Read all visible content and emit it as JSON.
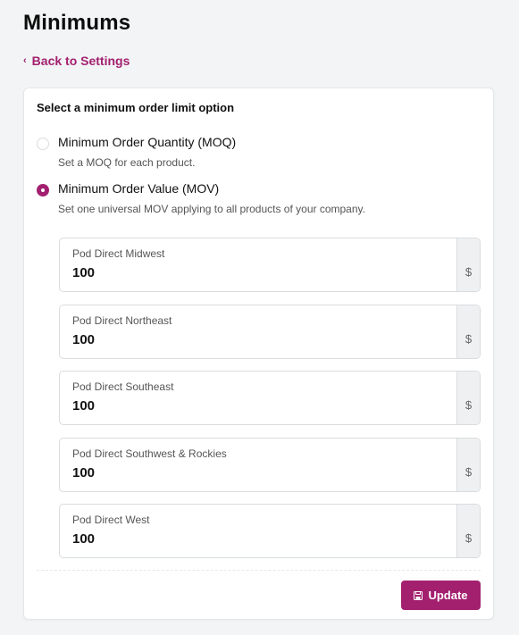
{
  "page": {
    "title": "Minimums"
  },
  "nav": {
    "back_label": "Back to Settings",
    "back_icon": "chevron-left-icon"
  },
  "card": {
    "title": "Select a minimum order limit option",
    "options": [
      {
        "label": "Minimum Order Quantity (MOQ)",
        "description": "Set a MOQ for each product.",
        "selected": false
      },
      {
        "label": "Minimum Order Value (MOV)",
        "description": "Set one universal MOV applying to all products of your company.",
        "selected": true
      }
    ],
    "fields": [
      {
        "label": "Pod Direct Midwest",
        "value": "100",
        "addon": "$"
      },
      {
        "label": "Pod Direct Northeast",
        "value": "100",
        "addon": "$"
      },
      {
        "label": "Pod Direct Southeast",
        "value": "100",
        "addon": "$"
      },
      {
        "label": "Pod Direct Southwest & Rockies",
        "value": "100",
        "addon": "$"
      },
      {
        "label": "Pod Direct West",
        "value": "100",
        "addon": "$"
      }
    ],
    "update_label": "Update"
  },
  "colors": {
    "accent": "#a3206f",
    "background": "#f2f4f5"
  }
}
